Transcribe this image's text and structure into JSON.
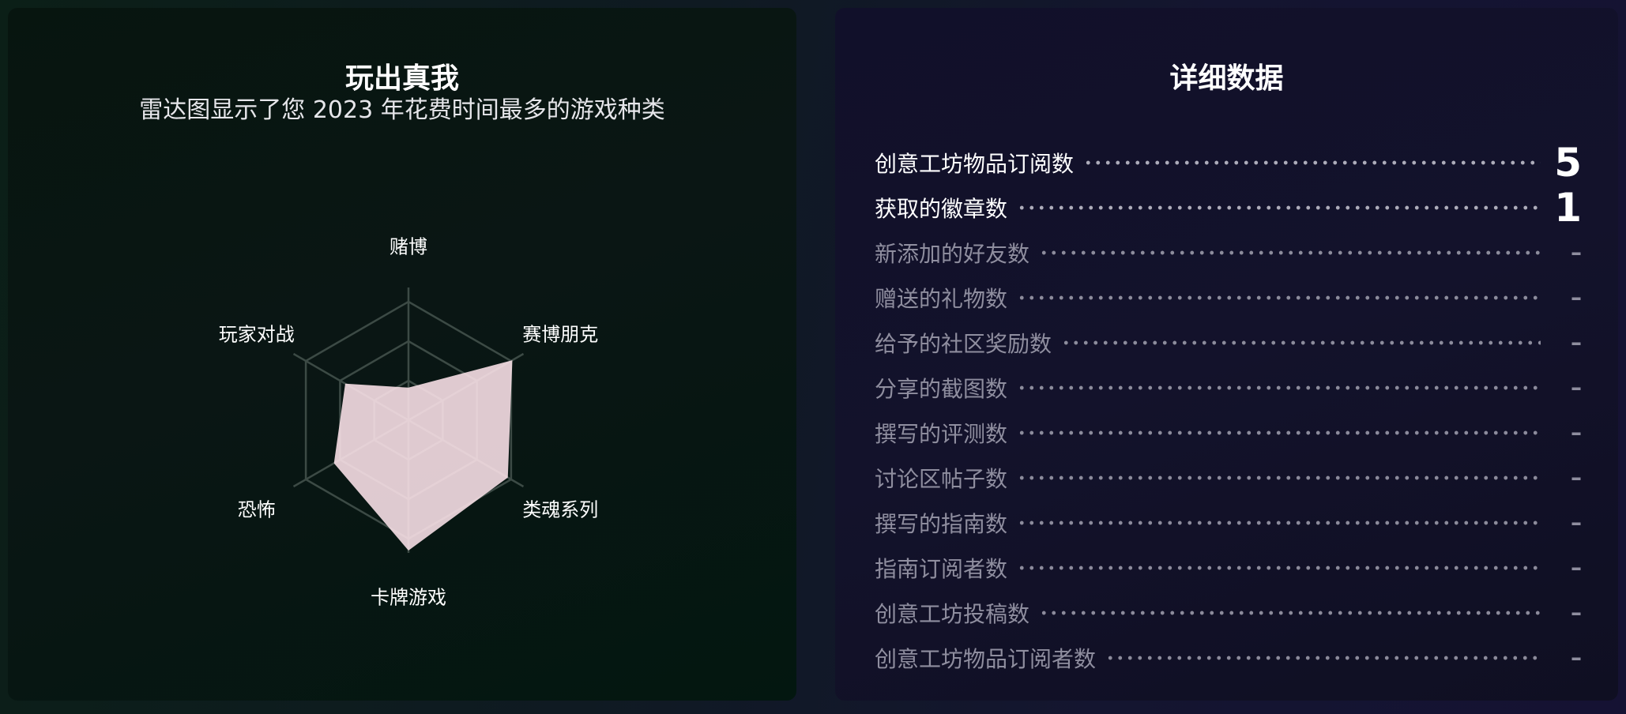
{
  "left_panel": {
    "title": "玩出真我",
    "subtitle": "雷达图显示了您 2023 年花费时间最多的游戏种类"
  },
  "chart_data": {
    "type": "radar",
    "title": "玩出真我",
    "axes": [
      "赌博",
      "赛博朋克",
      "类魂系列",
      "卡牌游戏",
      "恐怖",
      "玩家对战"
    ],
    "values": [
      0.25,
      0.92,
      0.88,
      1.0,
      0.66,
      0.56
    ],
    "range": [
      0,
      1
    ],
    "rings": 3,
    "fill_color": "#fde4ea",
    "grid_color": "#3c4a45"
  },
  "right_panel": {
    "title": "详细数据",
    "stats": [
      {
        "label": "创意工坊物品订阅数",
        "value": "5",
        "active": true
      },
      {
        "label": "获取的徽章数",
        "value": "1",
        "active": true
      },
      {
        "label": "新添加的好友数",
        "value": "–",
        "active": false
      },
      {
        "label": "赠送的礼物数",
        "value": "–",
        "active": false
      },
      {
        "label": "给予的社区奖励数",
        "value": "–",
        "active": false
      },
      {
        "label": "分享的截图数",
        "value": "–",
        "active": false
      },
      {
        "label": "撰写的评测数",
        "value": "–",
        "active": false
      },
      {
        "label": "讨论区帖子数",
        "value": "–",
        "active": false
      },
      {
        "label": "撰写的指南数",
        "value": "–",
        "active": false
      },
      {
        "label": "指南订阅者数",
        "value": "–",
        "active": false
      },
      {
        "label": "创意工坊投稿数",
        "value": "–",
        "active": false
      },
      {
        "label": "创意工坊物品订阅者数",
        "value": "–",
        "active": false
      }
    ]
  }
}
